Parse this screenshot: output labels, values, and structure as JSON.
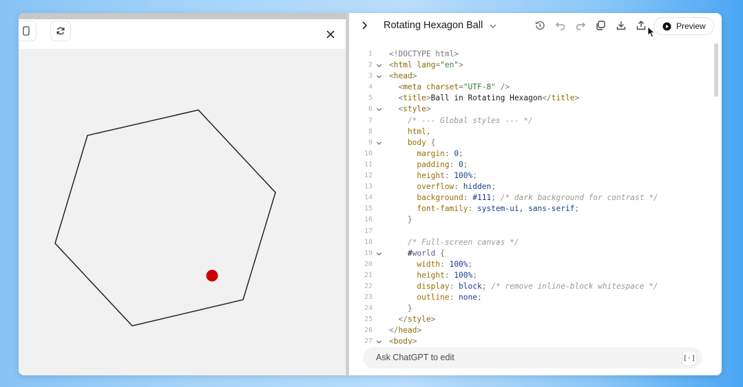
{
  "preview": {
    "close_icon": "close-icon",
    "ball_color": "#cc0000"
  },
  "editor": {
    "title": "Rotating Hexagon Ball",
    "preview_label": "Preview",
    "ask_placeholder": "Ask ChatGPT to edit",
    "ask_icon_glyph": "[·]"
  },
  "code_lines": [
    {
      "n": "1",
      "fold": false,
      "segs": [
        [
          "c-punct",
          "<!DOCTYPE html>"
        ]
      ]
    },
    {
      "n": "2",
      "fold": true,
      "segs": [
        [
          "c-punct",
          "<"
        ],
        [
          "c-tag",
          "html "
        ],
        [
          "c-attr",
          "lang"
        ],
        [
          "c-punct",
          "="
        ],
        [
          "c-str",
          "\"en\""
        ],
        [
          "c-punct",
          ">"
        ]
      ]
    },
    {
      "n": "3",
      "fold": true,
      "segs": [
        [
          "c-punct",
          "<"
        ],
        [
          "c-tag",
          "head"
        ],
        [
          "c-punct",
          ">"
        ]
      ]
    },
    {
      "n": "4",
      "fold": false,
      "segs": [
        [
          "c-punct",
          "  <"
        ],
        [
          "c-tag",
          "meta "
        ],
        [
          "c-attr",
          "charset"
        ],
        [
          "c-punct",
          "="
        ],
        [
          "c-str",
          "\"UTF-8\""
        ],
        [
          "c-punct",
          " />"
        ]
      ]
    },
    {
      "n": "5",
      "fold": false,
      "segs": [
        [
          "c-punct",
          "  <"
        ],
        [
          "c-tag",
          "title"
        ],
        [
          "c-punct",
          ">"
        ],
        [
          "c-sel",
          "Ball in Rotating Hexagon"
        ],
        [
          "c-punct",
          "</"
        ],
        [
          "c-tag",
          "title"
        ],
        [
          "c-punct",
          ">"
        ]
      ]
    },
    {
      "n": "6",
      "fold": true,
      "segs": [
        [
          "c-punct",
          "  <"
        ],
        [
          "c-tag",
          "style"
        ],
        [
          "c-punct",
          ">"
        ]
      ]
    },
    {
      "n": "7",
      "fold": false,
      "segs": [
        [
          "c-cmt",
          "    /* --- Global styles --- */"
        ]
      ]
    },
    {
      "n": "8",
      "fold": false,
      "segs": [
        [
          "c-prop",
          "    html"
        ],
        [
          "c-punct",
          ","
        ]
      ]
    },
    {
      "n": "9",
      "fold": true,
      "segs": [
        [
          "c-prop",
          "    body "
        ],
        [
          "c-punct",
          "{"
        ]
      ]
    },
    {
      "n": "10",
      "fold": false,
      "segs": [
        [
          "c-prop",
          "      margin"
        ],
        [
          "c-punct",
          ": "
        ],
        [
          "c-val",
          "0"
        ],
        [
          "c-punct",
          ";"
        ]
      ]
    },
    {
      "n": "11",
      "fold": false,
      "segs": [
        [
          "c-prop",
          "      padding"
        ],
        [
          "c-punct",
          ": "
        ],
        [
          "c-val",
          "0"
        ],
        [
          "c-punct",
          ";"
        ]
      ]
    },
    {
      "n": "12",
      "fold": false,
      "segs": [
        [
          "c-prop",
          "      height"
        ],
        [
          "c-punct",
          ": "
        ],
        [
          "c-val",
          "100%"
        ],
        [
          "c-punct",
          ";"
        ]
      ]
    },
    {
      "n": "13",
      "fold": false,
      "segs": [
        [
          "c-prop",
          "      overflow"
        ],
        [
          "c-punct",
          ": "
        ],
        [
          "c-val",
          "hidden"
        ],
        [
          "c-punct",
          ";"
        ]
      ]
    },
    {
      "n": "14",
      "fold": false,
      "segs": [
        [
          "c-prop",
          "      background"
        ],
        [
          "c-punct",
          ": "
        ],
        [
          "c-val",
          "#111"
        ],
        [
          "c-punct",
          "; "
        ],
        [
          "c-cmt",
          "/* dark background for contrast */"
        ]
      ]
    },
    {
      "n": "15",
      "fold": false,
      "segs": [
        [
          "c-prop",
          "      font-family"
        ],
        [
          "c-punct",
          ": "
        ],
        [
          "c-val",
          "system-ui, sans-serif"
        ],
        [
          "c-punct",
          ";"
        ]
      ]
    },
    {
      "n": "16",
      "fold": false,
      "segs": [
        [
          "c-punct",
          "    }"
        ]
      ]
    },
    {
      "n": "17",
      "fold": false,
      "segs": []
    },
    {
      "n": "18",
      "fold": false,
      "segs": [
        [
          "c-cmt",
          "    /* Full-screen canvas */"
        ]
      ]
    },
    {
      "n": "19",
      "fold": true,
      "segs": [
        [
          "c-sel",
          "    #"
        ],
        [
          "c-id",
          "world"
        ],
        [
          "c-punct",
          " {"
        ]
      ]
    },
    {
      "n": "20",
      "fold": false,
      "segs": [
        [
          "c-prop",
          "      width"
        ],
        [
          "c-punct",
          ": "
        ],
        [
          "c-val",
          "100%"
        ],
        [
          "c-punct",
          ";"
        ]
      ]
    },
    {
      "n": "21",
      "fold": false,
      "segs": [
        [
          "c-prop",
          "      height"
        ],
        [
          "c-punct",
          ": "
        ],
        [
          "c-val",
          "100%"
        ],
        [
          "c-punct",
          ";"
        ]
      ]
    },
    {
      "n": "22",
      "fold": false,
      "segs": [
        [
          "c-prop",
          "      display"
        ],
        [
          "c-punct",
          ": "
        ],
        [
          "c-val",
          "block"
        ],
        [
          "c-punct",
          "; "
        ],
        [
          "c-cmt",
          "/* remove inline-block whitespace */"
        ]
      ]
    },
    {
      "n": "23",
      "fold": false,
      "segs": [
        [
          "c-prop",
          "      outline"
        ],
        [
          "c-punct",
          ": "
        ],
        [
          "c-val",
          "none"
        ],
        [
          "c-punct",
          ";"
        ]
      ]
    },
    {
      "n": "24",
      "fold": false,
      "segs": [
        [
          "c-punct",
          "    }"
        ]
      ]
    },
    {
      "n": "25",
      "fold": false,
      "segs": [
        [
          "c-punct",
          "  </"
        ],
        [
          "c-tag",
          "style"
        ],
        [
          "c-punct",
          ">"
        ]
      ]
    },
    {
      "n": "26",
      "fold": false,
      "segs": [
        [
          "c-punct",
          "</"
        ],
        [
          "c-tag",
          "head"
        ],
        [
          "c-punct",
          ">"
        ]
      ]
    },
    {
      "n": "27",
      "fold": true,
      "segs": [
        [
          "c-punct",
          "<"
        ],
        [
          "c-tag",
          "body"
        ],
        [
          "c-punct",
          ">"
        ]
      ]
    }
  ]
}
